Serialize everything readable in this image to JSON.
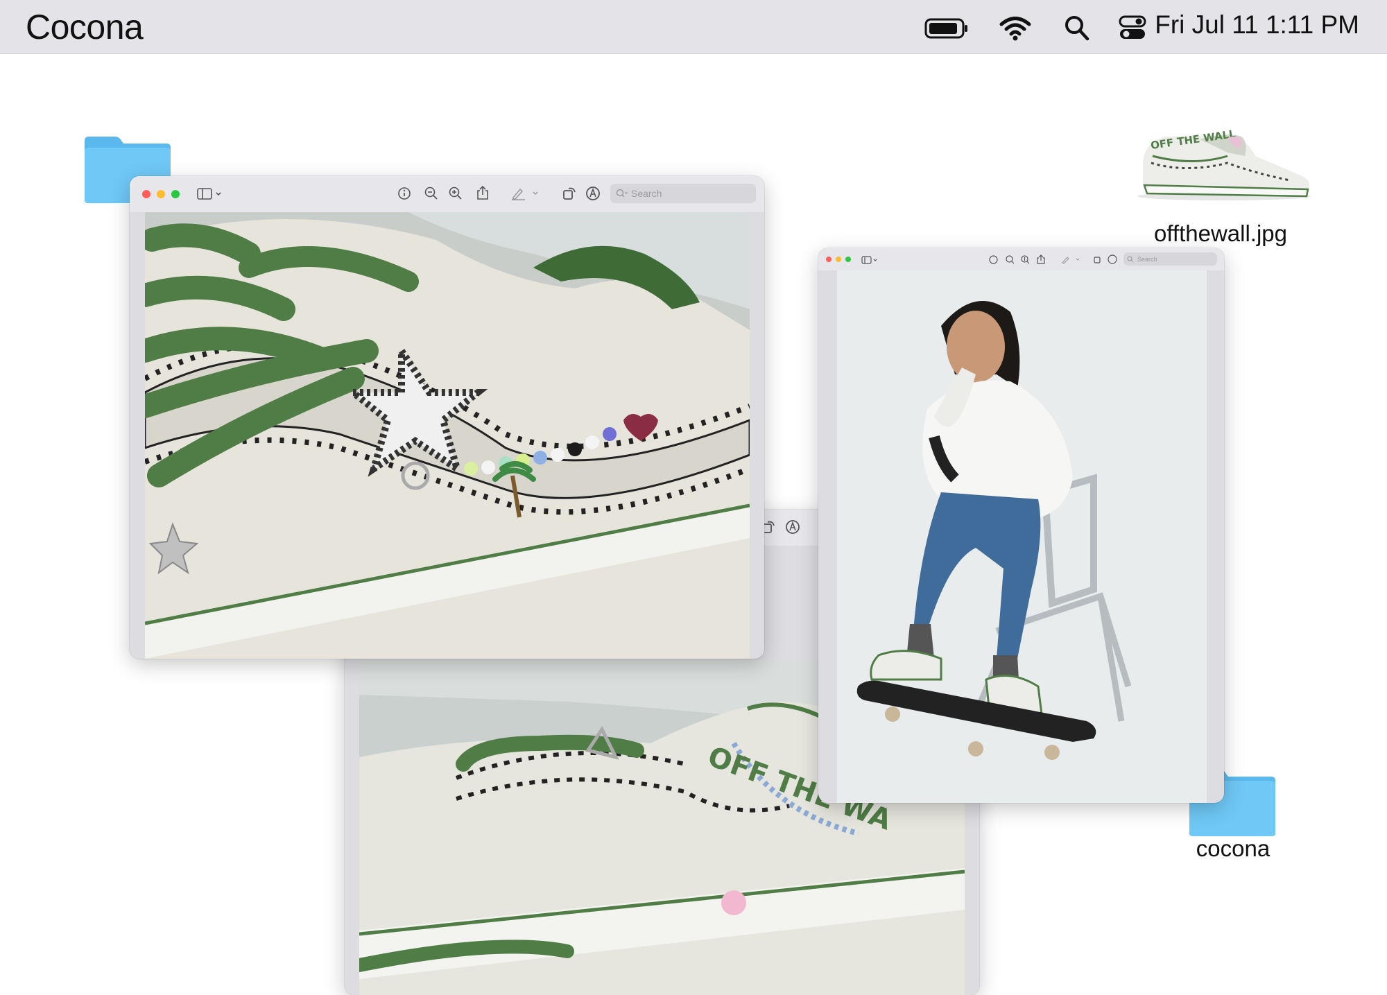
{
  "menubar": {
    "app_name": "Cocona",
    "clock": "Fri Jul 11 1:11 PM",
    "icons": [
      "battery-icon",
      "wifi-icon",
      "search-icon",
      "control-center-icon"
    ]
  },
  "desktop": {
    "file_icon_label": "offthewall.jpg",
    "folder_label": "cocona"
  },
  "preview_window": {
    "search_placeholder": "Search",
    "toolbar_icons": [
      "sidebar-icon",
      "info-icon",
      "zoom-out-icon",
      "zoom-in-icon",
      "share-icon",
      "markup-icon",
      "rotate-icon",
      "annotate-icon"
    ]
  },
  "colors": {
    "folder_blue": "#6fc8f6",
    "shoe_green": "#4f7d45",
    "close": "#ff5f57",
    "minimize": "#febc2e",
    "zoom": "#28c840"
  }
}
